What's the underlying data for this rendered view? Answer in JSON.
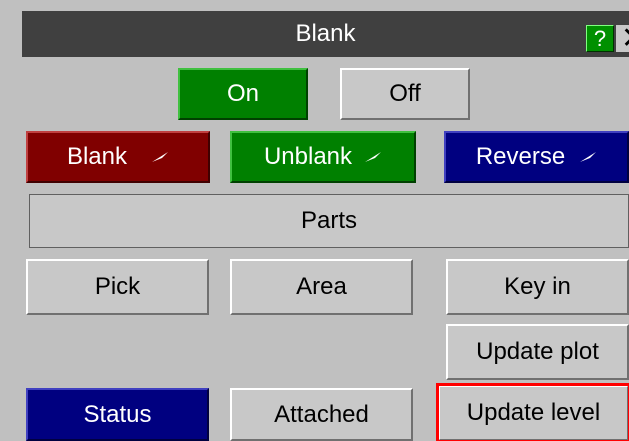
{
  "panel": {
    "title": "Blank",
    "help_label": "?",
    "close_label": "✕"
  },
  "toggle": {
    "on_label": "On",
    "off_label": "Off"
  },
  "actions": {
    "blank_label": "Blank",
    "unblank_label": "Unblank",
    "reverse_label": "Reverse"
  },
  "entity": {
    "parts_label": "Parts"
  },
  "select": {
    "pick_label": "Pick",
    "area_label": "Area",
    "keyin_label": "Key in"
  },
  "update": {
    "plot_label": "Update plot",
    "level_label": "Update level"
  },
  "bottom": {
    "status_label": "Status",
    "attached_label": "Attached"
  },
  "colors": {
    "panel_bg": "#c0c0c0",
    "titlebar": "#404040",
    "green": "#008000",
    "darkred": "#800000",
    "navy": "#000080",
    "highlight": "#ff0000"
  }
}
